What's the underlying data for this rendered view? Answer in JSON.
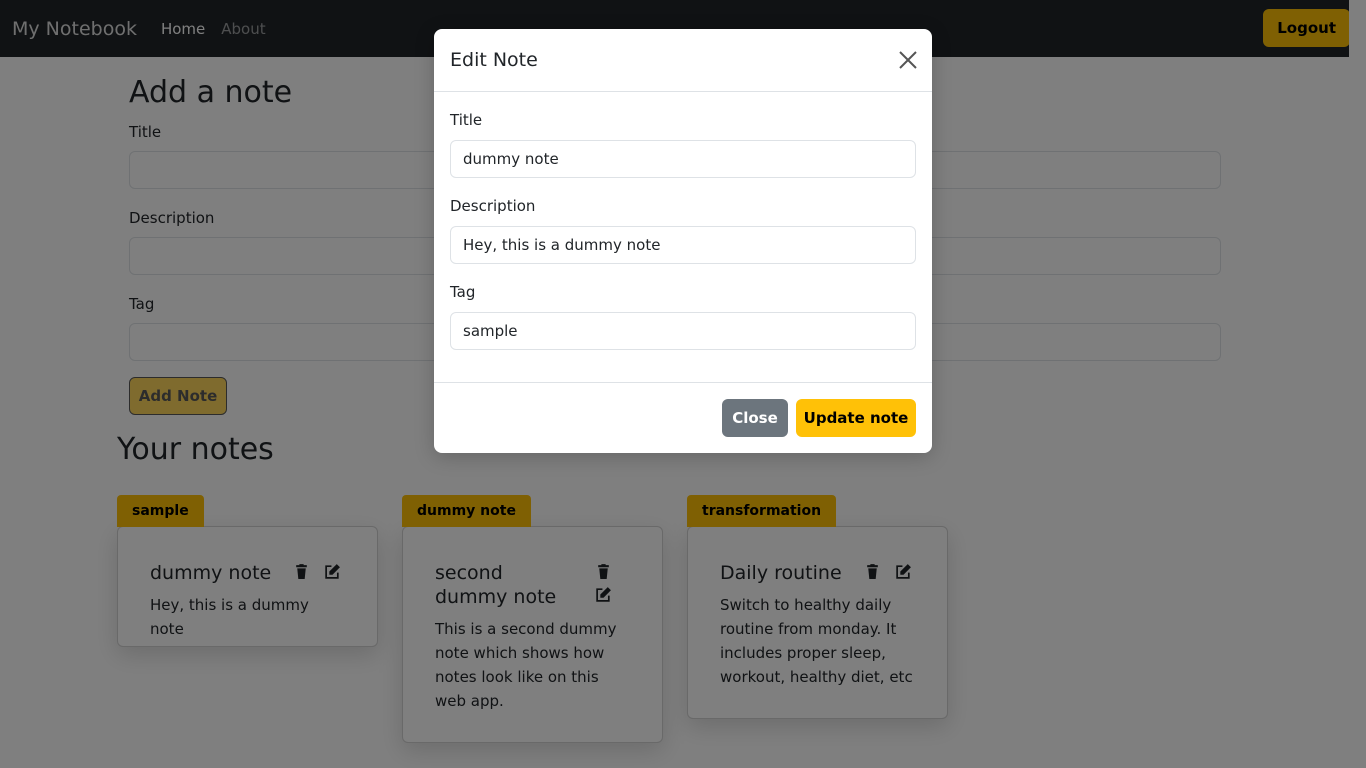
{
  "navbar": {
    "brand": "My Notebook",
    "links": [
      "Home",
      "About"
    ],
    "logout_label": "Logout"
  },
  "add_note": {
    "heading": "Add a note",
    "title_label": "Title",
    "description_label": "Description",
    "tag_label": "Tag",
    "button_label": "Add Note"
  },
  "notes": {
    "heading": "Your notes",
    "items": [
      {
        "tag": "sample",
        "title": "dummy note",
        "description": "Hey, this is a dummy note"
      },
      {
        "tag": "dummy note",
        "title": "second dummy note",
        "description": "This is a second dummy note which shows how notes look like on this web app."
      },
      {
        "tag": "transformation",
        "title": "Daily routine",
        "description": "Switch to healthy daily routine from monday. It includes proper sleep, workout, healthy diet, etc"
      }
    ]
  },
  "modal": {
    "title": "Edit Note",
    "title_label": "Title",
    "title_value": "dummy note",
    "description_label": "Description",
    "description_value": "Hey, this is a dummy note",
    "tag_label": "Tag",
    "tag_value": "sample",
    "close_label": "Close",
    "update_label": "Update note"
  },
  "colors": {
    "navbar_bg": "#212529",
    "accent": "#ffc107",
    "secondary": "#6c757d"
  },
  "icons": [
    "trash-icon",
    "edit-icon",
    "close-icon"
  ]
}
